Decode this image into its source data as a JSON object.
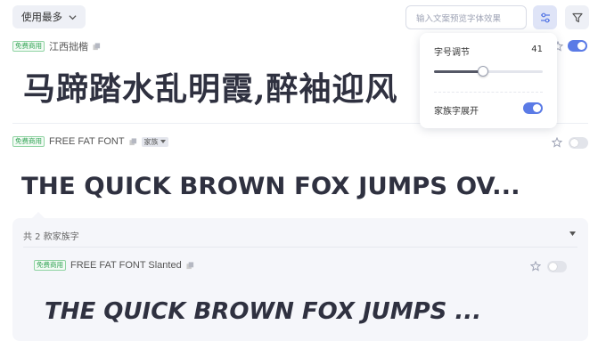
{
  "toolbar": {
    "sort_label": "使用最多",
    "search_placeholder": "输入文案预览字体效果"
  },
  "fonts": [
    {
      "badge": "免费商用",
      "name": "江西拙楷",
      "preview": "马蹄踏水乱明霞,醉袖迎风",
      "starred": false,
      "enabled": true
    },
    {
      "badge": "免费商用",
      "name": "FREE FAT FONT",
      "family_tag": "家族",
      "preview": "THE QUICK BROWN FOX JUMPS OV...",
      "starred": false,
      "enabled": false
    }
  ],
  "family_panel": {
    "count_text": "共 2 款家族字",
    "item": {
      "badge": "免费商用",
      "name": "FREE FAT FONT Slanted",
      "preview": "THE QUICK BROWN FOX JUMPS ...",
      "starred": false,
      "enabled": false
    }
  },
  "popover": {
    "size_label": "字号调节",
    "size_value": "41",
    "size_slider_fraction": 0.45,
    "family_expand_label": "家族字展开",
    "family_expand_on": true
  },
  "colors": {
    "accent": "#5b7be6",
    "badge_green": "#31a354",
    "text_dark": "#2f3140"
  },
  "icons": {
    "sort": "chevron-down-icon",
    "settings": "sliders-icon",
    "filter": "filter-icon",
    "copy": "copy-icon",
    "star": "star-icon"
  }
}
